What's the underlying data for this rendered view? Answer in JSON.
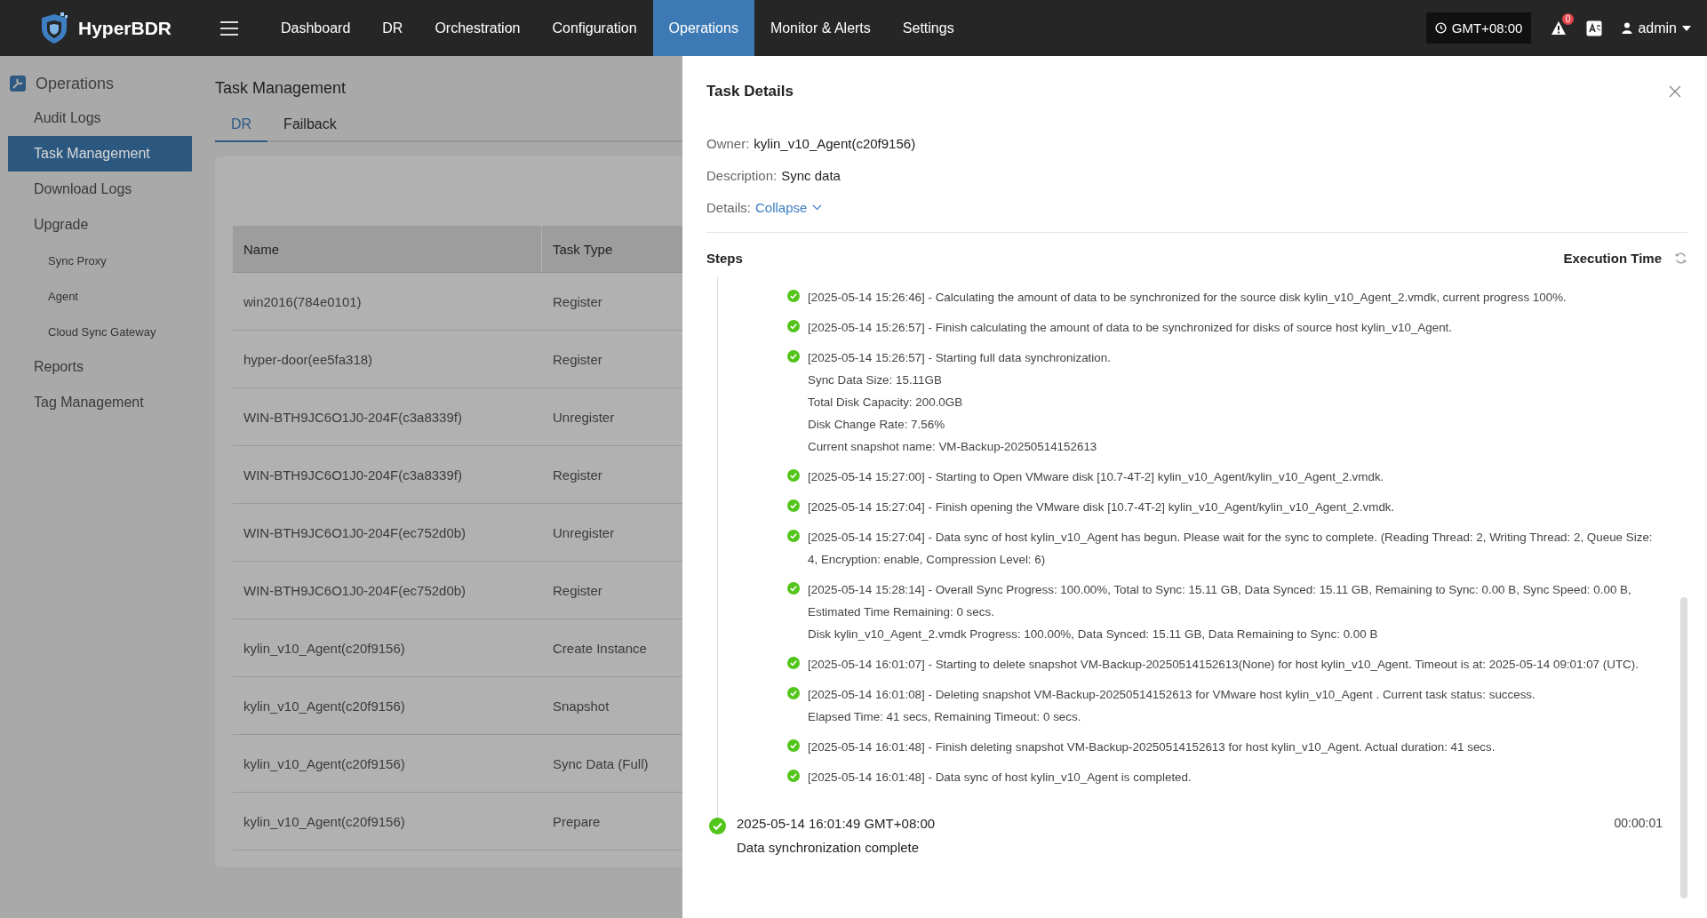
{
  "topbar": {
    "brand": "HyperBDR",
    "nav": [
      {
        "label": "Dashboard",
        "selected": false
      },
      {
        "label": "DR",
        "selected": false
      },
      {
        "label": "Orchestration",
        "selected": false
      },
      {
        "label": "Configuration",
        "selected": false
      },
      {
        "label": "Operations",
        "selected": true
      },
      {
        "label": "Monitor & Alerts",
        "selected": false
      },
      {
        "label": "Settings",
        "selected": false
      }
    ],
    "timezone": "GMT+08:00",
    "alert_count": "0",
    "user": "admin"
  },
  "sidebar": {
    "title": "Operations",
    "items": [
      {
        "label": "Audit Logs",
        "selected": false
      },
      {
        "label": "Task Management",
        "selected": true
      },
      {
        "label": "Download Logs",
        "selected": false
      },
      {
        "label": "Upgrade",
        "selected": false,
        "children": [
          {
            "label": "Sync Proxy",
            "selected": false
          },
          {
            "label": "Agent",
            "selected": false
          },
          {
            "label": "Cloud Sync Gateway",
            "selected": false
          }
        ]
      },
      {
        "label": "Reports",
        "selected": false
      },
      {
        "label": "Tag Management",
        "selected": false
      }
    ]
  },
  "page": {
    "title": "Task Management",
    "tabs": [
      {
        "label": "DR",
        "selected": true
      },
      {
        "label": "Failback",
        "selected": false
      }
    ],
    "table": {
      "columns": [
        "Name",
        "Task Type"
      ],
      "rows": [
        [
          "win2016(784e0101)",
          "Register"
        ],
        [
          "hyper-door(ee5fa318)",
          "Register"
        ],
        [
          "WIN-BTH9JC6O1J0-204F(c3a8339f)",
          "Unregister"
        ],
        [
          "WIN-BTH9JC6O1J0-204F(c3a8339f)",
          "Register"
        ],
        [
          "WIN-BTH9JC6O1J0-204F(ec752d0b)",
          "Unregister"
        ],
        [
          "WIN-BTH9JC6O1J0-204F(ec752d0b)",
          "Register"
        ],
        [
          "kylin_v10_Agent(c20f9156)",
          "Create Instance"
        ],
        [
          "kylin_v10_Agent(c20f9156)",
          "Snapshot"
        ],
        [
          "kylin_v10_Agent(c20f9156)",
          "Sync Data (Full)"
        ],
        [
          "kylin_v10_Agent(c20f9156)",
          "Prepare"
        ]
      ]
    }
  },
  "drawer": {
    "title": "Task Details",
    "fields": [
      {
        "label": "Owner:",
        "value": "kylin_v10_Agent(c20f9156)",
        "kind": "text"
      },
      {
        "label": "Description:",
        "value": "Sync data",
        "kind": "text"
      },
      {
        "label": "Details:",
        "value": "Collapse",
        "kind": "toggle"
      }
    ],
    "steps_heading": "Steps",
    "time_heading": "Execution Time",
    "log": [
      {
        "lines": [
          "[2025-05-14 15:26:46] - Calculating the amount of data to be synchronized for the source disk kylin_v10_Agent_2.vmdk, current progress 100%."
        ]
      },
      {
        "lines": [
          "[2025-05-14 15:26:57] - Finish calculating the amount of data to be synchronized for disks of source host kylin_v10_Agent."
        ]
      },
      {
        "lines": [
          "[2025-05-14 15:26:57] - Starting full data synchronization.",
          "Sync Data Size: 15.11GB",
          "Total Disk Capacity: 200.0GB",
          "Disk Change Rate: 7.56%",
          "Current snapshot name: VM-Backup-20250514152613"
        ]
      },
      {
        "lines": [
          "[2025-05-14 15:27:00] - Starting to Open VMware disk [10.7-4T-2] kylin_v10_Agent/kylin_v10_Agent_2.vmdk."
        ]
      },
      {
        "lines": [
          "[2025-05-14 15:27:04] - Finish opening the VMware disk [10.7-4T-2] kylin_v10_Agent/kylin_v10_Agent_2.vmdk."
        ]
      },
      {
        "lines": [
          "[2025-05-14 15:27:04] - Data sync of host kylin_v10_Agent has begun. Please wait for the sync to complete. (Reading Thread: 2, Writing Thread: 2, Queue Size: 4, Encryption: enable, Compression Level: 6)"
        ]
      },
      {
        "lines": [
          "[2025-05-14 15:28:14] - Overall Sync Progress: 100.00%, Total to Sync: 15.11 GB, Data Synced: 15.11 GB, Remaining to Sync: 0.00 B, Sync Speed: 0.00 B, Estimated Time Remaining: 0 secs.",
          "Disk kylin_v10_Agent_2.vmdk Progress: 100.00%, Data Synced: 15.11 GB, Data Remaining to Sync: 0.00 B"
        ]
      },
      {
        "lines": [
          "[2025-05-14 16:01:07] - Starting to delete snapshot VM-Backup-20250514152613(None) for host kylin_v10_Agent. Timeout is at: 2025-05-14 09:01:07 (UTC)."
        ]
      },
      {
        "lines": [
          "[2025-05-14 16:01:08] - Deleting snapshot VM-Backup-20250514152613 for VMware host kylin_v10_Agent . Current task status: success.",
          "Elapsed Time: 41 secs, Remaining Timeout: 0 secs."
        ]
      },
      {
        "lines": [
          "[2025-05-14 16:01:48] - Finish deleting snapshot VM-Backup-20250514152613 for host kylin_v10_Agent. Actual duration: 41 secs."
        ]
      },
      {
        "lines": [
          "[2025-05-14 16:01:48] - Data sync of host kylin_v10_Agent is completed."
        ]
      }
    ],
    "final": {
      "time": "2025-05-14 16:01:49 GMT+08:00",
      "text": "Data synchronization complete",
      "duration": "00:00:01"
    }
  }
}
